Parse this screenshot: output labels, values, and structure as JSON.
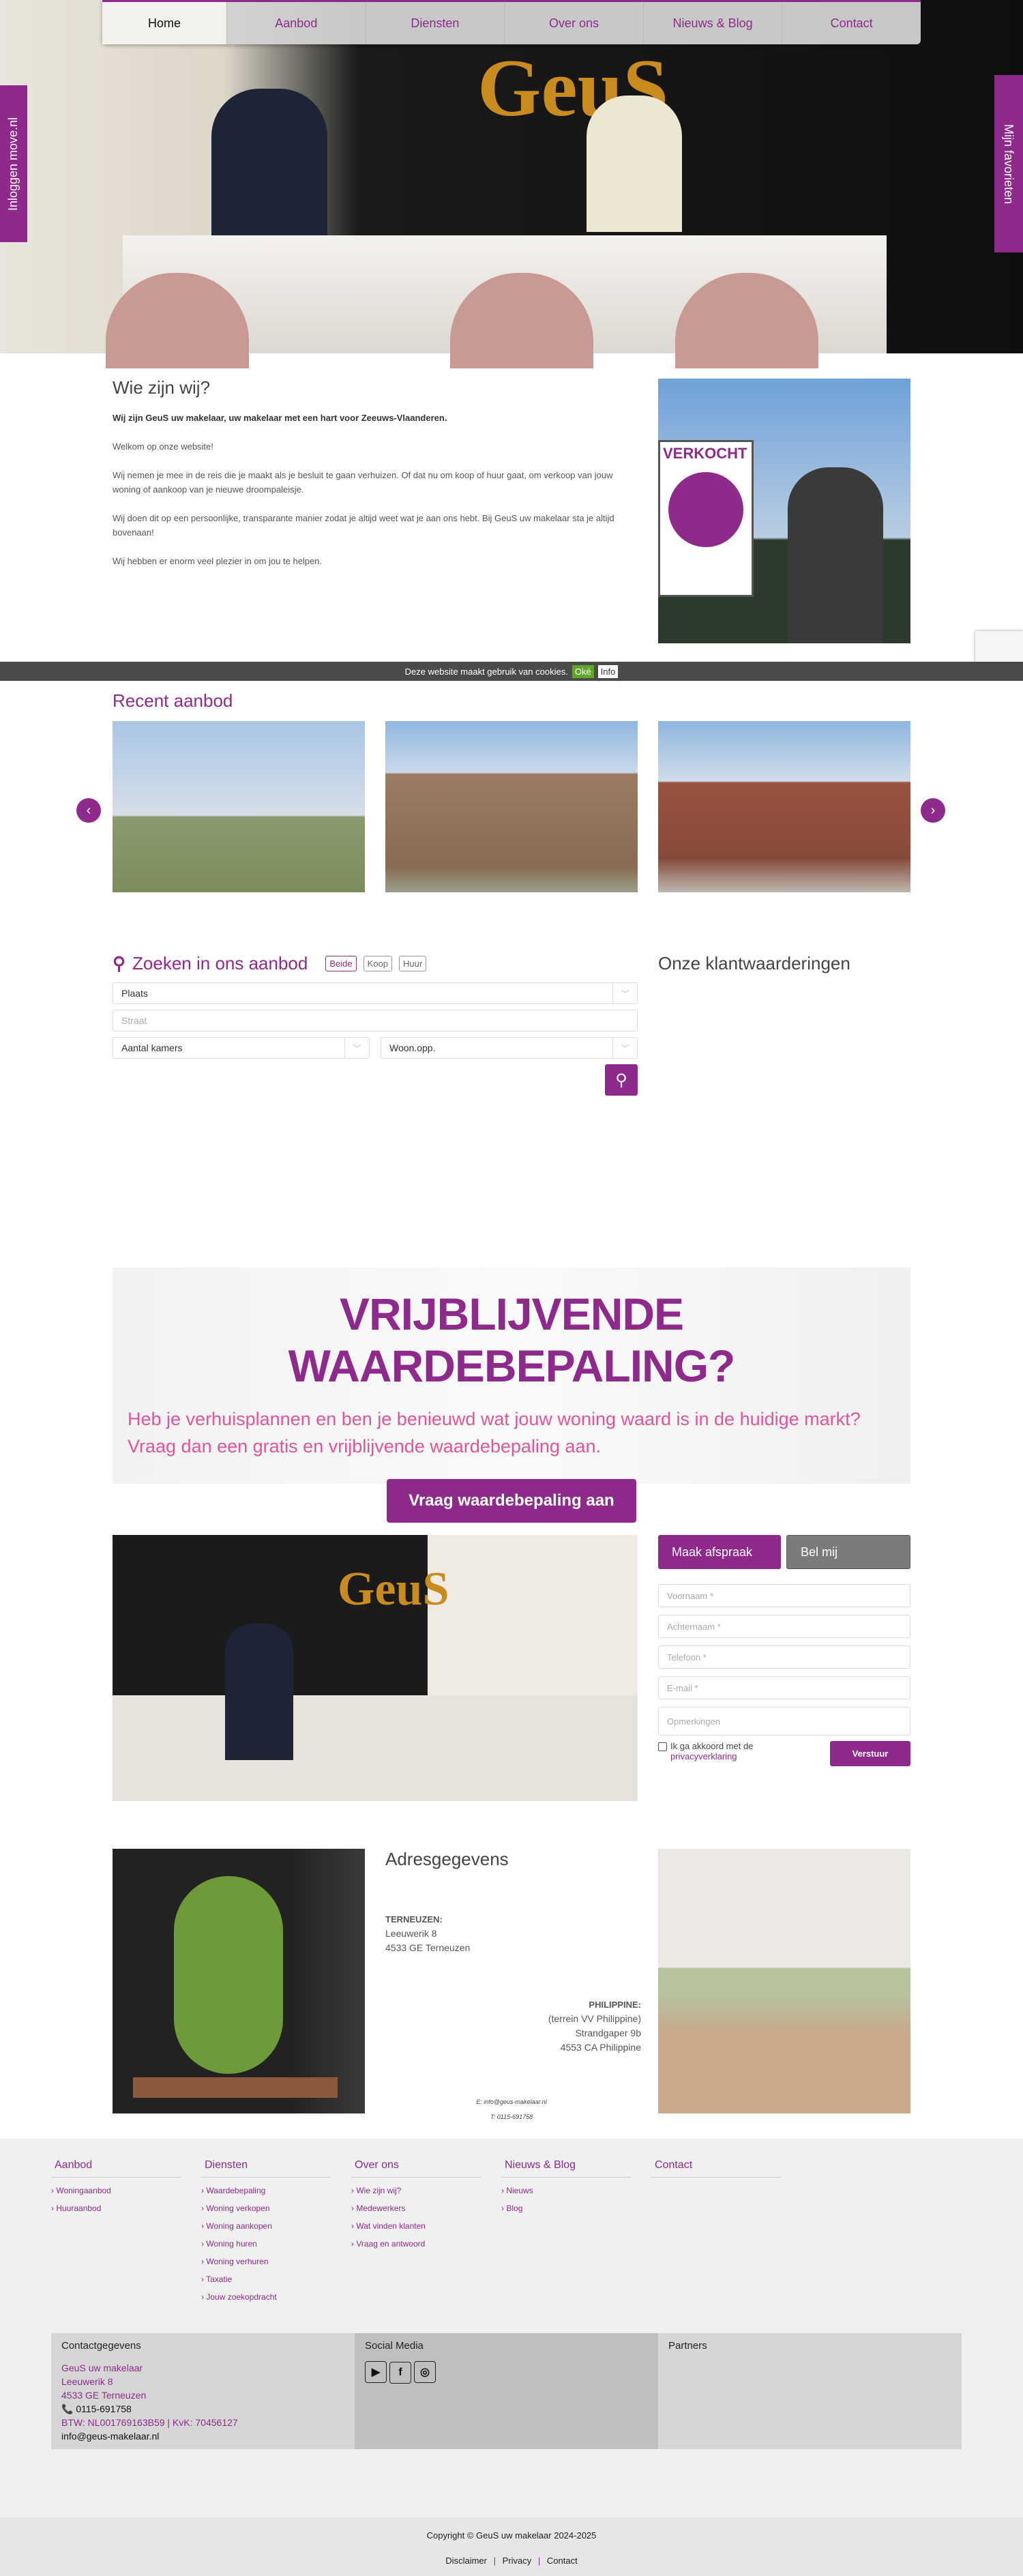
{
  "nav": {
    "items": [
      "Home",
      "Aanbod",
      "Diensten",
      "Over ons",
      "Nieuws & Blog",
      "Contact"
    ]
  },
  "hero": {
    "logo_text": "GeuS"
  },
  "side": {
    "login": "Inloggen move.nl",
    "favorites": "Mijn favorieten"
  },
  "intro": {
    "title": "Wie zijn wij?",
    "lead": "Wij zijn GeuS uw makelaar, uw makelaar met een hart voor Zeeuws-Vlaanderen.",
    "paragraphs": [
      "Welkom op onze website!",
      "Wij nemen je mee in de reis die je maakt als je besluit te gaan verhuizen. Of dat nu om koop of huur gaat, om verkoop van jouw woning of aankoop van je nieuwe droompaleisje.",
      "Wij doen dit op een persoonlijke, transparante manier zodat je altijd weet wat je aan ons hebt. Bij GeuS uw makelaar sta je altijd bovenaan!",
      "Wij hebben er enorm veel plezier in om jou te helpen."
    ],
    "sign_text": "VERKOCHT"
  },
  "cookie": {
    "text": "Deze website maakt gebruik van cookies.",
    "ok": "Oké",
    "info": "Info"
  },
  "recent": {
    "title": "Recent aanbod"
  },
  "search": {
    "title": "Zoeken in ons aanbod",
    "filters": [
      "Beide",
      "Koop",
      "Huur"
    ],
    "active_filter": "Beide",
    "place": "Plaats",
    "street_placeholder": "Straat",
    "rooms": "Aantal kamers",
    "area": "Woon.opp."
  },
  "reviews": {
    "title": "Onze klantwaarderingen"
  },
  "banner": {
    "title": "VRIJBLIJVENDE WAARDEBEPALING?",
    "line1": "Heb je verhuisplannen en ben je benieuwd wat jouw woning waard is in de huidige markt?",
    "line2": "Vraag dan een gratis en vrijblijvende waardebepaling aan.",
    "button": "Vraag waardebepaling aan"
  },
  "contact_form": {
    "tab_active": "Maak afspraak",
    "tab_other": "Bel mij",
    "fields": [
      "Voornaam *",
      "Achternaam *",
      "Telefoon *",
      "E-mail *"
    ],
    "remarks": "Opmerkingen",
    "consent": "Ik ga akkoord met de",
    "privacy_link": "privacyverklaring",
    "submit": "Verstuur"
  },
  "address": {
    "title": "Adresgegevens",
    "terneuzen": {
      "label": "TERNEUZEN:",
      "lines": [
        "Leeuwerik 8",
        "4533 GE Terneuzen"
      ]
    },
    "philippine": {
      "label": "PHILIPPINE:",
      "lines": [
        "(terrein VV Philippine)",
        "Strandgaper 9b",
        "4553 CA Philippine"
      ]
    },
    "email": "E: info@geus-makelaar.nl",
    "phone": "T: 0115-691758"
  },
  "footer": {
    "columns": [
      {
        "title": "Aanbod",
        "links": [
          "Woningaanbod",
          "Huuraanbod"
        ]
      },
      {
        "title": "Diensten",
        "links": [
          "Waardebepaling",
          "Woning verkopen",
          "Woning aankopen",
          "Woning huren",
          "Woning verhuren",
          "Taxatie",
          "Jouw zoekopdracht"
        ]
      },
      {
        "title": "Over ons",
        "links": [
          "Wie zijn wij?",
          "Medewerkers",
          "Wat vinden klanten",
          "Vraag en antwoord"
        ]
      },
      {
        "title": "Nieuws & Blog",
        "links": [
          "Nieuws",
          "Blog"
        ]
      },
      {
        "title": "Contact",
        "links": []
      }
    ],
    "contact": {
      "title": "Contactgegevens",
      "name": "GeuS uw makelaar",
      "street": "Leeuwerik 8",
      "city": "4533 GE Terneuzen",
      "phone": "0115-691758",
      "btw": "BTW: NL001769163B59 | KvK: 70456127",
      "email": "info@geus-makelaar.nl"
    },
    "social": {
      "title": "Social Media",
      "icons": [
        "youtube",
        "facebook",
        "instagram"
      ]
    },
    "partners": {
      "title": "Partners"
    },
    "copyright": "Copyright © GeuS uw makelaar 2024-2025",
    "links": [
      "Disclaimer",
      "Privacy",
      "Contact"
    ]
  },
  "colors": {
    "accent": "#8e2a8b",
    "pink": "#e0559a"
  }
}
